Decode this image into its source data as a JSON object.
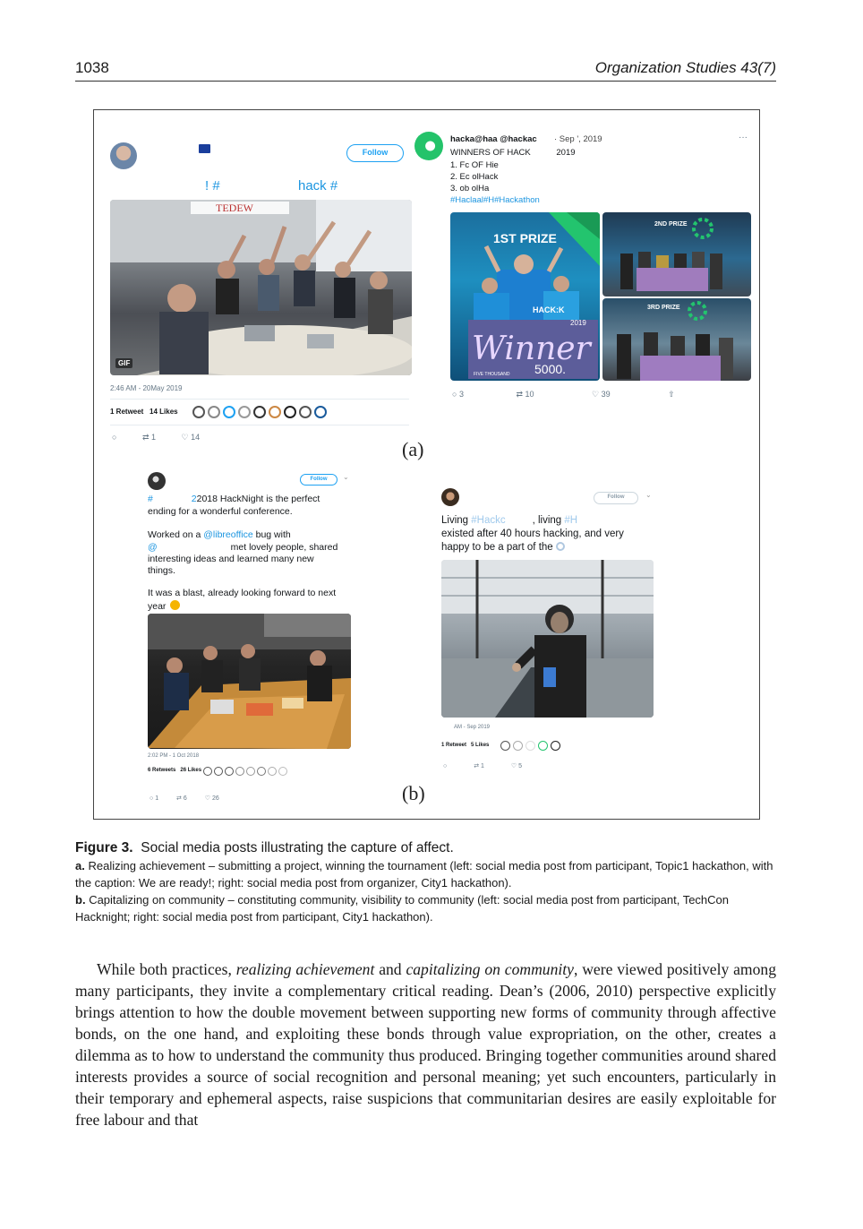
{
  "header": {
    "page_number": "1038",
    "journal": "Organization Studies 43(7)"
  },
  "figure": {
    "panel_a_label": "(a)",
    "panel_b_label": "(b)",
    "tweet_a_left": {
      "follow": "Follow",
      "headline_left": "! #",
      "headline_right": "hack #",
      "gif_badge": "GIF",
      "banner_text": "TEDEW",
      "timestamp": "2:46 AM - 20May 2019",
      "retweets": "1 Retweet",
      "likes": "14 Likes",
      "action_retweet": "1",
      "action_like": "14"
    },
    "tweet_a_right": {
      "handle": "hacka@haa @hackac",
      "date": "· Sep ', 2019",
      "more": "···",
      "line1": "WINNERS OF HACK",
      "line1_year": "2019",
      "list1": "1. Fc OF Hie",
      "list2": "2. Ec olHack",
      "list3": "3. ob olHa",
      "hashtags": "#Haclaal#H#Hackathon",
      "first_prize": "1ST PRIZE",
      "second_prize": "2ND PRIZE",
      "third_prize": "3RD PRIZE",
      "hack_sign": "HACK:K",
      "winner_year": "2019",
      "winner_word": "Winner",
      "five_thousand": "5000.",
      "five_thousand_small": "FIVE THOUSAND",
      "reply_count": "3",
      "retweet_count": "10",
      "like_count": "39"
    },
    "tweet_b_left": {
      "follow": "Follow",
      "line1_hash": "#",
      "line1_rest": "2018 HackNight is the perfect",
      "line2": "ending for a wonderful conference.",
      "line3_pre": "Worked on a ",
      "line3_link": "@libreoffice",
      "line3_post": " bug with",
      "line4_at": "@",
      "line4_post": "met lovely people, shared",
      "line5": "interesting ideas and learned many new",
      "line6": "things.",
      "line7": "It was a blast, already looking forward to next",
      "line8": "year",
      "timestamp": "2:02 PM - 1 Oct 2018",
      "retweets": "6 Retweets",
      "likes": "26 Likes",
      "action_reply": "1",
      "action_retweet": "6",
      "action_like": "26"
    },
    "tweet_b_right": {
      "follow": "Follow",
      "line1_pre": "Living ",
      "line1_hash": "#Hackc",
      "line1_mid": ", living ",
      "line1_hash2": "#H",
      "line2": "existed after 40 hours hacking, and very",
      "line3_pre": "happy to be a part of the",
      "timestamp": "AM - Sep 2019",
      "retweets": "1 Retweet",
      "likes": "5 Likes",
      "action_retweet": "1",
      "action_like": "5"
    }
  },
  "caption": {
    "title_label": "Figure 3.",
    "title_text": "Social media posts illustrating the capture of affect.",
    "a_label": "a.",
    "a_text": "Realizing achievement – submitting a project, winning the tournament (left: social media post from participant, Topic1 hackathon, with the caption: We are ready!; right: social media post from organizer, City1 hackathon).",
    "b_label": "b.",
    "b_text": "Capitalizing on community – constituting community, visibility to community (left: social media post from participant, TechCon Hacknight; right: social media post from participant, City1 hackathon)."
  },
  "body": {
    "p1_a": "While both practices, ",
    "p1_em1": "realizing achievement",
    "p1_b": " and ",
    "p1_em2": "capitalizing on community",
    "p1_c": ", were viewed positively among many participants, they invite a complementary critical reading. Dean’s (2006, 2010) perspective explicitly brings attention to how the double movement between supporting new forms of community through affective bonds, on the one hand, and exploiting these bonds through value expropriation, on the other, creates a dilemma as to how to understand the community thus produced. Bringing together communities around shared interests provides a source of social recognition and personal meaning; yet such encounters, particularly in their temporary and ephemeral aspects, raise suspicions that communitarian desires are easily exploitable for free labour and that"
  }
}
